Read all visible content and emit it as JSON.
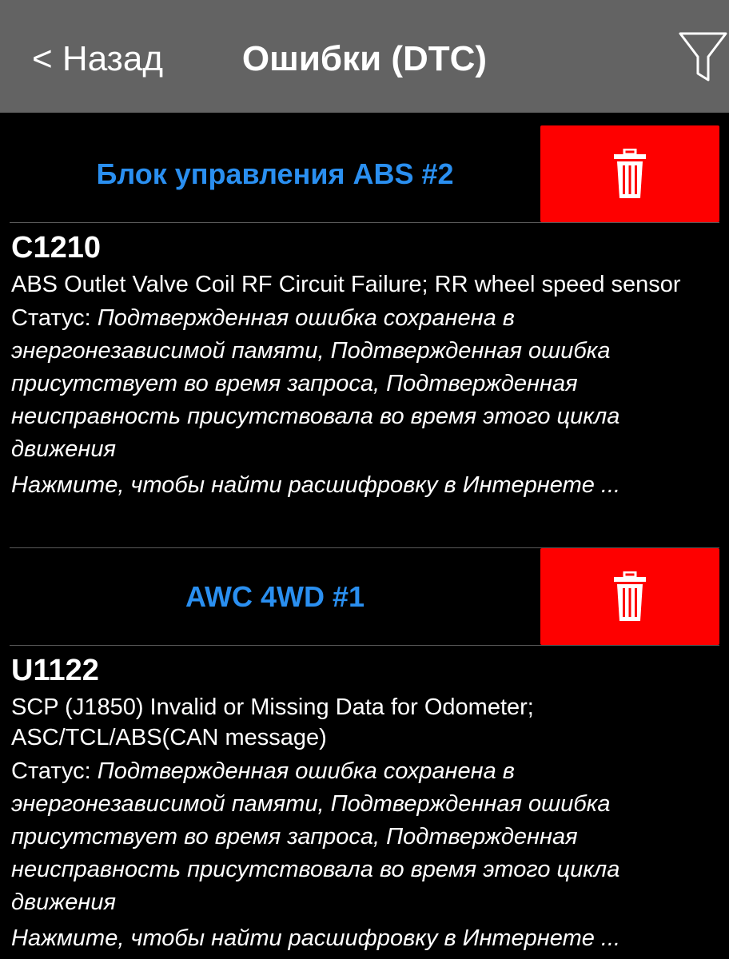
{
  "header": {
    "back_label": "< Назад",
    "title": "Ошибки (DTC)",
    "filter_icon": "filter-icon"
  },
  "colors": {
    "header_bg": "#636363",
    "background": "#000000",
    "module_title": "#2a8ff0",
    "delete_bg": "#fe0000",
    "text": "#ffffff"
  },
  "modules": [
    {
      "name": "Блок управления ABS #2",
      "delete_icon": "trash-icon",
      "dtc": {
        "code": "C1210",
        "description": "ABS Outlet Valve Coil RF Circuit Failure; RR wheel speed sensor",
        "status_label": "Статус: ",
        "status_value": "Подтвержденная ошибка сохранена в энергонезависимой памяти, Подтвержденная ошибка присутствует во время запроса, Подтвержденная неисправность присутствовала во время этого цикла движения",
        "search_hint": "Нажмите, чтобы найти расшифровку в Интернете ..."
      }
    },
    {
      "name": "AWC 4WD #1",
      "delete_icon": "trash-icon",
      "dtc": {
        "code": "U1122",
        "description": "SCP (J1850) Invalid or Missing Data for Odometer; ASC/TCL/ABS(CAN message)",
        "status_label": "Статус: ",
        "status_value": "Подтвержденная ошибка сохранена в энергонезависимой памяти, Подтвержденная ошибка присутствует во время запроса, Подтвержденная неисправность присутствовала во время этого цикла движения",
        "search_hint": "Нажмите, чтобы найти расшифровку в Интернете ..."
      }
    }
  ]
}
